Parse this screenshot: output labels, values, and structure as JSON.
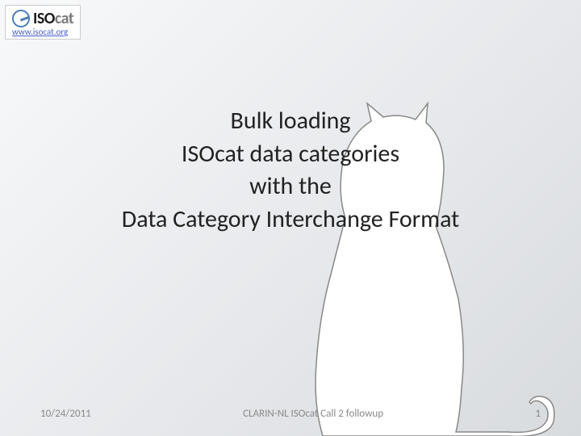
{
  "logo": {
    "iso": "ISO",
    "cat": "cat",
    "url": "www.isocat.org"
  },
  "title": {
    "line1": "Bulk loading",
    "line2": "ISOcat data categories",
    "line3": "with the",
    "line4": "Data Category Interchange Format"
  },
  "footer": {
    "date": "10/24/2011",
    "event": "CLARIN-NL ISOcat Call 2 followup",
    "page": "1"
  }
}
